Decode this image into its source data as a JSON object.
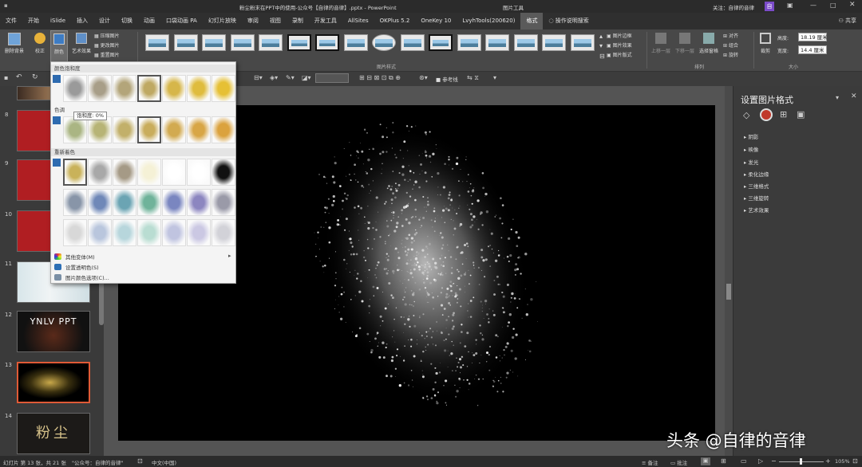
{
  "titlebar": {
    "title": "粉尘粉末在PPT中的使用-公众号【自律的音律】.pptx  -  PowerPoint",
    "picture_tools": "图片工具",
    "follow": "关注：自律的音律",
    "avatar_letter": "自"
  },
  "menu": [
    "文件",
    "开始",
    "iSlide",
    "插入",
    "设计",
    "切换",
    "动画",
    "口袋动画 PA",
    "幻灯片放映",
    "审阅",
    "视图",
    "录制",
    "开发工具",
    "AllSites",
    "OKPlus 5.2",
    "OneKey 10",
    "LvyhTools(200620)",
    "格式"
  ],
  "menu_active": "格式",
  "tell_me": "操作说明搜索",
  "share": "共享",
  "ribbon": {
    "remove_bg": "删除背景",
    "corrections": "校正",
    "color": "颜色",
    "artistic": "艺术效果",
    "compress": "压缩图片",
    "change": "更改图片",
    "reset": "重置图片",
    "styles_group": "图片样式",
    "border": "图片边框",
    "effects": "图片效果",
    "layout": "图片版式",
    "bring_forward": "上移一层",
    "send_backward": "下移一层",
    "selection_pane": "选择窗格",
    "align": "对齐",
    "group": "组合",
    "rotate": "旋转",
    "arrange_group": "排列",
    "crop": "裁剪",
    "height_label": "高度:",
    "height_value": "18.19 厘米",
    "width_label": "宽度:",
    "width_value": "14.4 厘米",
    "size_group": "大小"
  },
  "qat": {
    "ref_line": "参考线"
  },
  "slides": [
    {
      "num": "8"
    },
    {
      "num": "9"
    },
    {
      "num": "10"
    },
    {
      "num": "11"
    },
    {
      "num": "12",
      "text": "YNLV PPT"
    },
    {
      "num": "13"
    },
    {
      "num": "14",
      "text": "粉尘"
    }
  ],
  "dropdown": {
    "saturation": "颜色饱和度",
    "tone": "色调",
    "recolor": "重新着色",
    "more_variations": "其他变体(M)",
    "set_transparent": "设置透明色(S)",
    "color_options": "图片颜色选项(C)...",
    "tooltip": "饱和度: 0%"
  },
  "pane": {
    "title": "设置图片格式",
    "items": [
      "阴影",
      "映像",
      "发光",
      "柔化边缘",
      "三维格式",
      "三维旋转",
      "艺术效果"
    ]
  },
  "status": {
    "slide_info": "幻灯片 第 13 张，共 21 张",
    "account": "\"公众号：自律的音律\"",
    "language": "中文(中国)",
    "notes": "备注",
    "comments": "批注",
    "zoom": "105%"
  },
  "watermark": "头条 @自律的音律",
  "colors": {
    "accent": "#c0504d",
    "selected_slide": "#e05a36",
    "slide_bg": "#000000"
  }
}
